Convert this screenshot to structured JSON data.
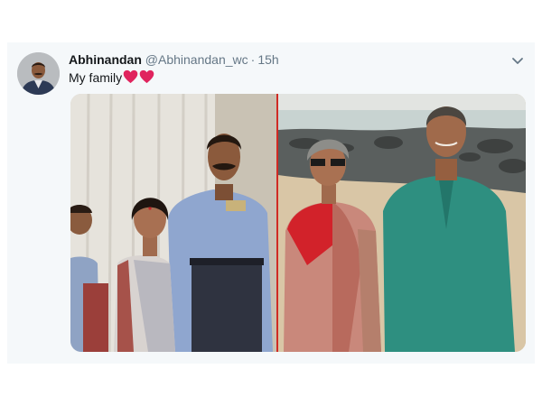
{
  "tweet": {
    "display_name": "Abhinandan",
    "handle": "@Abhinandan_wc",
    "separator": "·",
    "time": "15h",
    "text": "My family",
    "emoji": [
      "heart-emoji",
      "heart-emoji"
    ]
  },
  "icons": {
    "caret": "chevron-down-icon",
    "avatar": "avatar",
    "heart": "heart-emoji"
  },
  "colors": {
    "card_background": "#f5f8fa",
    "name": "#14171a",
    "secondary_text": "#657786",
    "heart": "#e0245e",
    "photo_divider": "#d02a24"
  }
}
